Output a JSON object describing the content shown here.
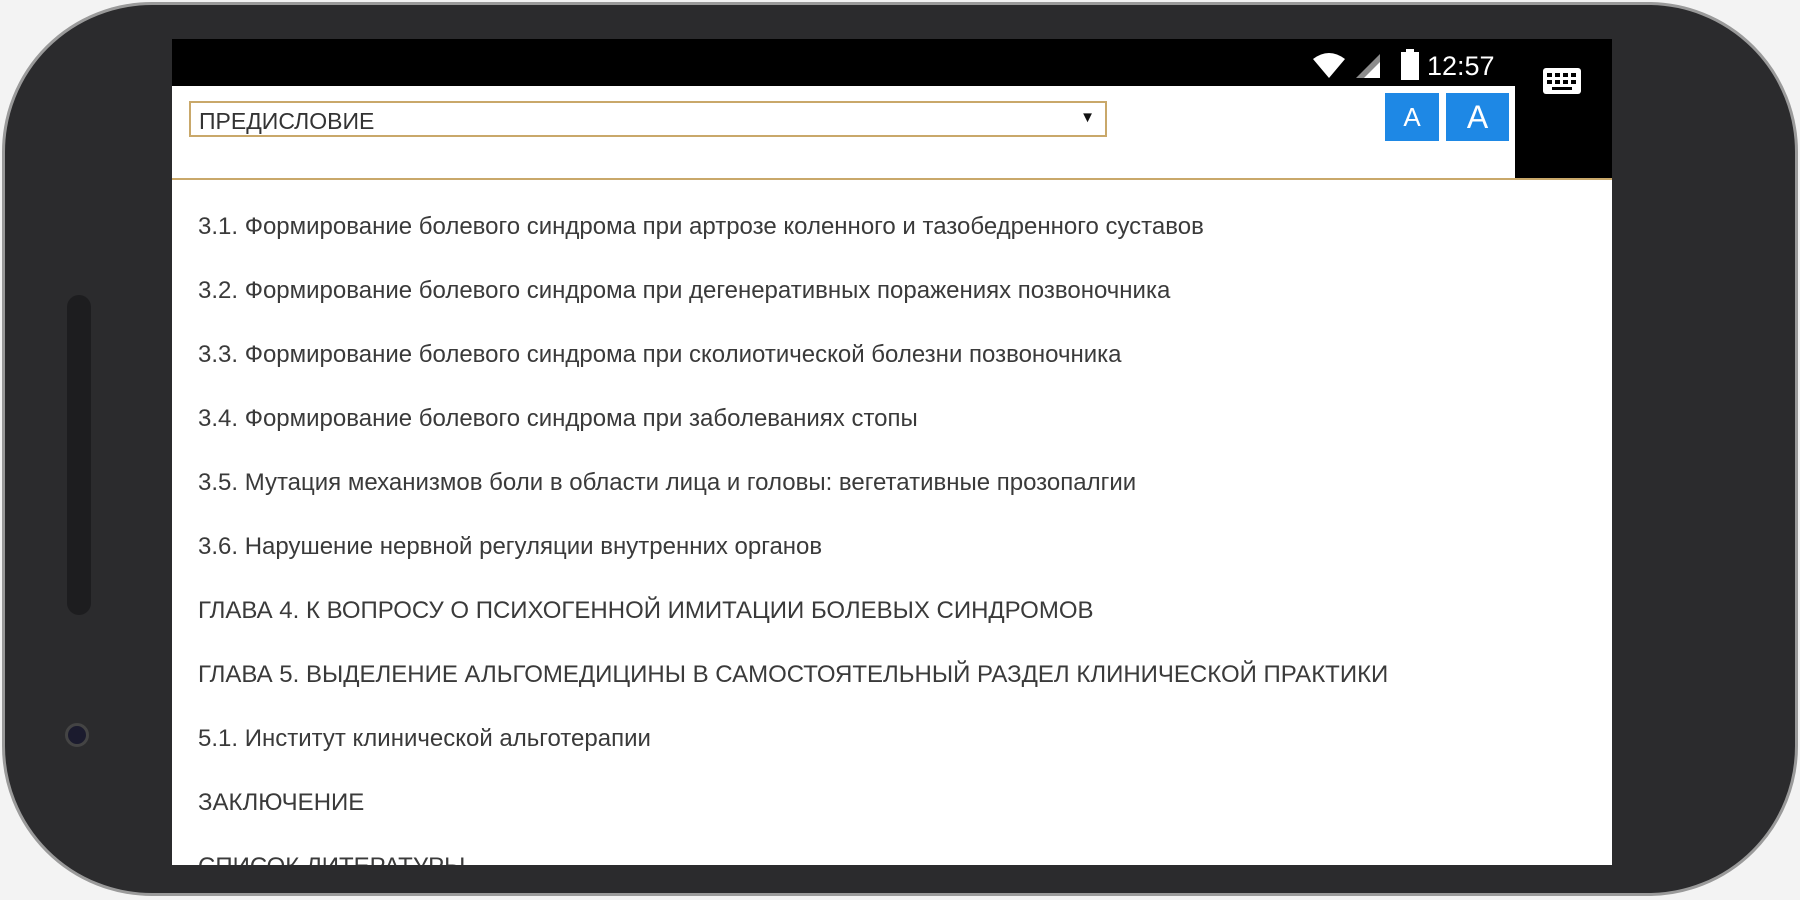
{
  "status_bar": {
    "time": "12:57"
  },
  "toolbar": {
    "chapter_select": "ПРЕДИСЛОВИЕ",
    "font_small_label": "A",
    "font_large_label": "A"
  },
  "toc": [
    "3.1. Формирование болевого синдрома при артрозе коленного и тазобедренного суставов",
    "3.2. Формирование болевого синдрома при дегенеративных поражениях позвоночника",
    "3.3. Формирование болевого синдрома при сколиотической болезни позвоночника",
    "3.4. Формирование болевого синдрома при заболеваниях стопы",
    "3.5. Мутация механизмов боли в области лица и головы: вегетативные прозопалгии",
    "3.6. Нарушение нервной регуляции внутренних органов",
    "ГЛАВА 4. К ВОПРОСУ О ПСИХОГЕННОЙ ИМИТАЦИИ БОЛЕВЫХ СИНДРОМОВ",
    "ГЛАВА 5. ВЫДЕЛЕНИЕ АЛЬГОМЕДИЦИНЫ В САМОСТОЯТЕЛЬНЫЙ РАЗДЕЛ КЛИНИЧЕСКОЙ ПРАКТИКИ",
    "5.1. Институт клинической альготерапии",
    "ЗАКЛЮЧЕНИЕ",
    "СПИСОК ЛИТЕРАТУРЫ"
  ],
  "colors": {
    "accent": "#1e88e5",
    "select_border": "#c9a86a",
    "phone_body": "#2b2b2d"
  },
  "icons": [
    "wifi-icon",
    "signal-icon",
    "battery-icon",
    "keyboard-icon",
    "dropdown-arrow-icon"
  ]
}
